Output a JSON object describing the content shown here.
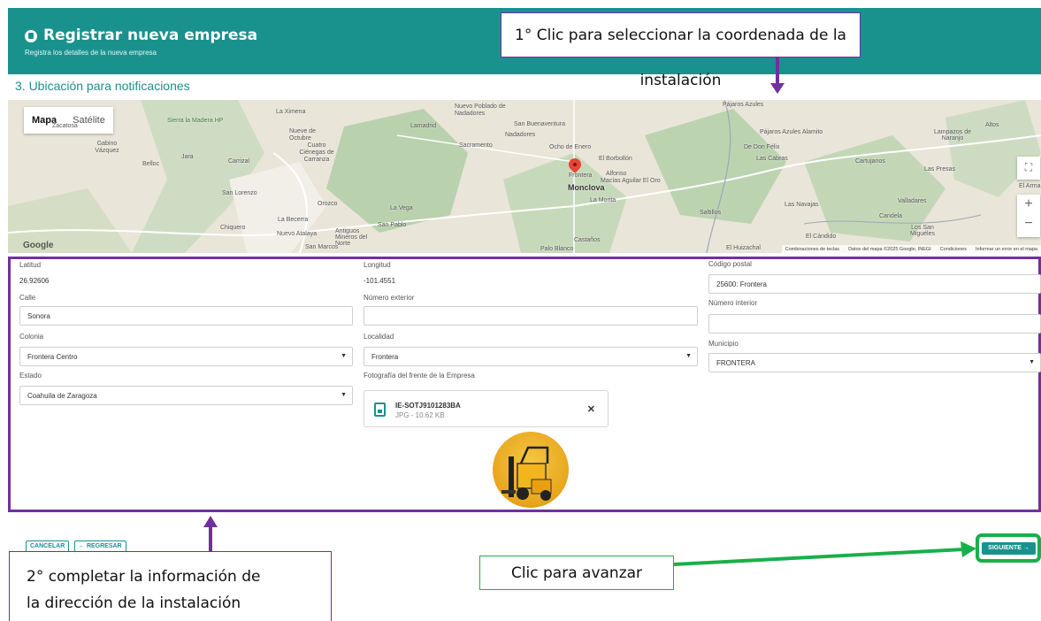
{
  "header": {
    "title": "Registrar nueva empresa",
    "subtitle": "Registra los detalles de la nueva empresa"
  },
  "section_title": "3. Ubicación para notificaciones",
  "map": {
    "type_control": {
      "map": "Mapa",
      "satellite": "Satélite"
    },
    "google_logo": "Google",
    "places": {
      "zacatosa": "Zacatosa",
      "sierra": "Sierra la Madera HP",
      "la_ximena": "La Ximena",
      "nuevo_poblado": "Nuevo Poblado de Nadadores",
      "san_buenaventura": "San Buenaventura",
      "nadadores": "Nadadores",
      "lamadrid": "Lamadrid",
      "sacramento": "Sacramento",
      "ocho_enero": "Ocho de Enero",
      "nueve_octubre": "Nueve de Octubre",
      "cuatro_cienegas": "Cuatro Ciénegas de Carranza",
      "gabino": "Gabino Vázquez",
      "jara": "Jara",
      "carrizal": "Carrizal",
      "belloc": "Belloc",
      "el_borbollon": "El Borbollón",
      "frontera": "Frontera",
      "alfonso": "Alfonso",
      "macias": "Macías Aguilar El Oro",
      "monclova": "Monclova",
      "la_morita": "La Morita",
      "san_lorenzo": "San Lorenzo",
      "orozco": "Orozco",
      "la_vega": "La Vega",
      "la_becerra": "La Becerra",
      "san_pablo": "San Pablo",
      "chiquero": "Chiquero",
      "nuevo_atalaya": "Nuevo Atalaya",
      "antiguos_mineros": "Antiguos Mineros del Norte",
      "san_marcos": "San Marcos",
      "castanos": "Castaños",
      "palo_blanco": "Palo Blanco",
      "pajaros_azules": "Pájaros Azules",
      "pajaros_alamito": "Pájaros Azules Alamito",
      "de_don_felix": "De Don Félix",
      "las_cabras": "Las Cabras",
      "cartujanos": "Cartujanos",
      "lampazos": "Lampazos de Naranjo",
      "altos": "Altos",
      "las_presas": "Las Presas",
      "el_arma": "El Arma",
      "saltillos": "Saltillos",
      "las_navajas": "Las Navajas",
      "valladares": "Valladares",
      "candela": "Candela",
      "el_candido": "El Cándido",
      "los_san_migueles": "Los San Miguéles",
      "el_huizachal": "El Huizachal"
    },
    "footer": {
      "shortcuts": "Combinaciones de teclas",
      "data": "Datos del mapa ©2025 Google, INEGI",
      "terms": "Condiciones",
      "report": "Informar un error en el mapa"
    }
  },
  "form": {
    "latitude": {
      "label": "Latitud",
      "value": "26.92606"
    },
    "longitude": {
      "label": "Longitud",
      "value": "-101.4551"
    },
    "postal_code": {
      "label": "Código postal",
      "value": "25600: Frontera"
    },
    "street": {
      "label": "Calle",
      "value": "Sonora"
    },
    "ext_number": {
      "label": "Número exterior",
      "value": ""
    },
    "int_number": {
      "label": "Número interior",
      "value": ""
    },
    "colonia": {
      "label": "Colonia",
      "value": "Frontera Centro"
    },
    "localidad": {
      "label": "Localidad",
      "value": "Frontera"
    },
    "municipio": {
      "label": "Municipio",
      "value": "FRONTERA"
    },
    "estado": {
      "label": "Estado",
      "value": "Coahuila de Zaragoza"
    },
    "photo": {
      "label": "Fotografía del frente de la Empresa",
      "file_name": "IE-SOTJ9101283BA",
      "file_meta": "JPG - 10.62 KB"
    }
  },
  "buttons": {
    "cancel": "CANCELAR",
    "back": "← REGRESAR",
    "next": "SIGUIENTE →"
  },
  "annotations": {
    "step1": "1° Clic para seleccionar la coordenada de la instalación",
    "step2_line1": "2° completar la información de",
    "step2_line2": "la dirección de la instalación",
    "advance": "Clic para avanzar"
  },
  "colors": {
    "primary": "#19928e",
    "annotation_purple": "#7030a0",
    "annotation_green": "#18b04a",
    "map_pin": "#ea4335"
  },
  "icons": {
    "header": "building-icon",
    "file": "image-file-icon",
    "close": "close-icon",
    "fullscreen": "fullscreen-icon",
    "zoom_in": "zoom-in-icon",
    "zoom_out": "zoom-out-icon"
  }
}
